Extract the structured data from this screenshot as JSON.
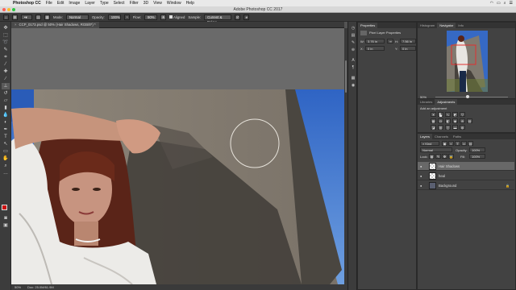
{
  "menubar": {
    "app": "Photoshop CC",
    "items": [
      "File",
      "Edit",
      "Image",
      "Layer",
      "Type",
      "Select",
      "Filter",
      "3D",
      "View",
      "Window",
      "Help"
    ]
  },
  "window_title": "Adobe Photoshop CC 2017",
  "options": {
    "mode_label": "Mode:",
    "mode_value": "Normal",
    "opacity_label": "Opacity:",
    "opacity_value": "100%",
    "flow_label": "Flow:",
    "flow_value": "90%",
    "aligned_label": "Aligned",
    "sample_label": "Sample:",
    "sample_value": "Current & Below"
  },
  "document_tab": "CCP_0173.psd @ 50% (Hair Shadows, RGB/8*) *",
  "status": {
    "zoom": "50%",
    "doc": "Doc: 25.0M/61.9M"
  },
  "properties": {
    "tabs": [
      "Properties"
    ],
    "title": "Pixel Layer Properties",
    "w_label": "W:",
    "w_value": "3.76 in",
    "h_label": "H:",
    "h_value": "7.56 in",
    "x_label": "X:",
    "x_value": "0 in",
    "y_label": "Y:",
    "y_value": "0 in",
    "go_label": "GO"
  },
  "histogram_tabs": [
    "Histogram",
    "Navigator",
    "Info"
  ],
  "navigator_zoom": "50%",
  "libraries_tabs": [
    "Libraries",
    "Adjustments"
  ],
  "adjustments_title": "Add an adjustment",
  "layers_tabs": [
    "Layers",
    "Channels",
    "Paths"
  ],
  "layers": {
    "kind_label": "Kind",
    "blend_mode": "Normal",
    "opacity_label": "Opacity:",
    "opacity_value": "100%",
    "lock_label": "Lock:",
    "fill_label": "Fill:",
    "fill_value": "100%",
    "rows": [
      {
        "name": "Hair Shadows",
        "selected": true
      },
      {
        "name": "heal",
        "selected": false
      },
      {
        "name": "Background",
        "selected": false
      }
    ]
  },
  "icons": {
    "brush": "brush-icon",
    "stamp": "clone-stamp-icon",
    "eye": "eye-icon",
    "lock": "lock-icon"
  },
  "colors": {
    "foreground": "#cc1111",
    "background": "#ffffff",
    "accent": "#686868"
  }
}
